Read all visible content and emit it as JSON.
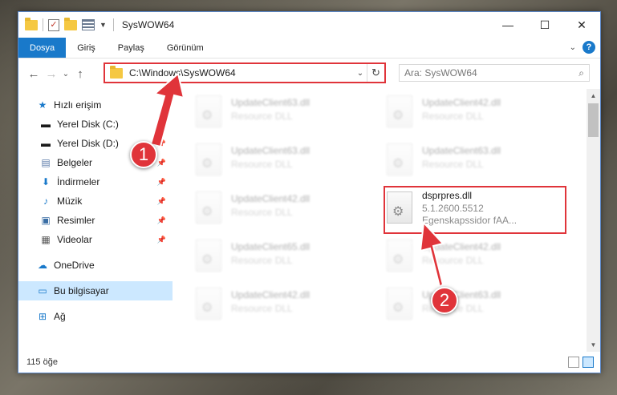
{
  "window": {
    "title": "SysWOW64"
  },
  "ribbon": {
    "tabs": [
      "Dosya",
      "Giriş",
      "Paylaş",
      "Görünüm"
    ]
  },
  "nav": {
    "address": "C:\\Windows\\SysWOW64",
    "search_placeholder": "Ara: SysWOW64"
  },
  "sidebar": {
    "items": [
      {
        "label": "Hızlı erişim",
        "icon": "star-icon",
        "pinned": false
      },
      {
        "label": "Yerel Disk (C:)",
        "icon": "drive-icon",
        "pinned": true
      },
      {
        "label": "Yerel Disk (D:)",
        "icon": "drive-icon",
        "pinned": true
      },
      {
        "label": "Belgeler",
        "icon": "document-icon",
        "pinned": true
      },
      {
        "label": "İndirmeler",
        "icon": "download-icon",
        "pinned": true
      },
      {
        "label": "Müzik",
        "icon": "music-icon",
        "pinned": true
      },
      {
        "label": "Resimler",
        "icon": "picture-icon",
        "pinned": true
      },
      {
        "label": "Videolar",
        "icon": "video-icon",
        "pinned": true
      },
      {
        "label": "OneDrive",
        "icon": "cloud-icon",
        "pinned": false
      },
      {
        "label": "Bu bilgisayar",
        "icon": "computer-icon",
        "pinned": false
      },
      {
        "label": "Ağ",
        "icon": "network-icon",
        "pinned": false
      }
    ]
  },
  "files": [
    {
      "name": "UpdateClient63.dll",
      "sub": "Resource DLL"
    },
    {
      "name": "UpdateClient42.dll",
      "sub": "Resource DLL"
    },
    {
      "name": "UpdateClient63.dll",
      "sub": "Resource DLL"
    },
    {
      "name": "UpdateClient63.dll",
      "sub": "Resource DLL"
    },
    {
      "name": "UpdateClient42.dll",
      "sub": "Resource DLL"
    },
    {
      "name": "dsprpres.dll",
      "version": "5.1.2600.5512",
      "sub": "Egenskapssidor fAA..."
    },
    {
      "name": "UpdateClient65.dll",
      "sub": "Resource DLL"
    },
    {
      "name": "UpdateClient42.dll",
      "sub": "Resource DLL"
    },
    {
      "name": "UpdateClient42.dll",
      "sub": "Resource DLL"
    },
    {
      "name": "UpdateClient63.dll",
      "sub": "Resource DLL"
    }
  ],
  "status": {
    "count": "115 öğe"
  },
  "callouts": [
    "1",
    "2"
  ],
  "colors": {
    "accent": "#1979ca",
    "highlight": "#e0343a"
  }
}
